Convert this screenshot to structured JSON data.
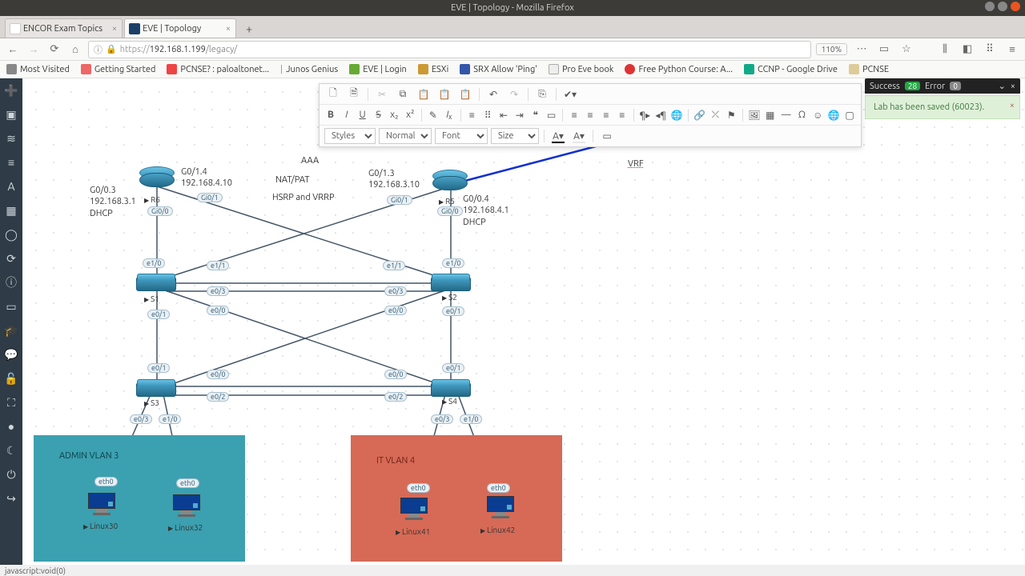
{
  "window_title": "EVE | Topology - Mozilla Firefox",
  "tabs": [
    {
      "label": "ENCOR Exam Topics",
      "active": false
    },
    {
      "label": "EVE | Topology",
      "active": true
    }
  ],
  "url": {
    "proto": "https://",
    "host": "192.168.1.199",
    "path": "/legacy/"
  },
  "zoom": "110%",
  "bookmarks": [
    {
      "label": "Most Visited",
      "color": "#888"
    },
    {
      "label": "Getting Started",
      "color": "#e66"
    },
    {
      "label": "PCNSE? : paloaltonet...",
      "color": "#e44"
    },
    {
      "label": "Junos Genius",
      "color": "#39a"
    },
    {
      "label": "EVE | Login",
      "color": "#6a3"
    },
    {
      "label": "ESXi",
      "color": "#c93"
    },
    {
      "label": "SRX Allow 'Ping'",
      "color": "#35a"
    },
    {
      "label": "Pro Eve book",
      "color": "#777"
    },
    {
      "label": "Free Python Course: A...",
      "color": "#d33"
    },
    {
      "label": "CCNP - Google Drive",
      "color": "#1a8"
    },
    {
      "label": "PCNSE",
      "color": "#aa8"
    }
  ],
  "notif": {
    "success_label": "Success",
    "success_count": "28",
    "error_label": "Error",
    "error_count": "0",
    "msg": "Lab has been saved (60023)."
  },
  "editor": {
    "styles": "Styles",
    "format": "Normal",
    "font": "Font",
    "size": "Size"
  },
  "topo": {
    "text_aaa": "AAA",
    "text_natpat": "NAT/PAT",
    "text_hsrp": "HSRP and VRRP",
    "text_vrf": "VRF",
    "r6_block": "G0/0.3\n192.168.3.1\nDHCP",
    "r6_g014": "G0/1.4\n192.168.4.10",
    "r5_g013": "G0/1.3\n192.168.3.10",
    "r5_block": "G0/0.4\n192.168.4.1\nDHCP",
    "nodes": {
      "r6": "R6",
      "r5": "R5",
      "s1": "S1",
      "s2": "S2",
      "s3": "S3",
      "s4": "S4",
      "l30": "Linux30",
      "l32": "Linux32",
      "l41": "Linux41",
      "l42": "Linux42"
    },
    "vlan3": "ADMIN VLAN 3",
    "vlan4": "IT VLAN 4",
    "ports": {
      "r6_gi01": "Gi0/1",
      "r6_gi00": "Gi0/0",
      "r5_gi01": "Gi0/1",
      "r5_gi00": "Gi0/0",
      "s1_e10": "e1/0",
      "s1_e11": "e1/1",
      "s1_e03": "e0/3",
      "s1_e00": "e0/0",
      "s1_e01": "e0/1",
      "s2_e10": "e1/0",
      "s2_e11": "e1/1",
      "s2_e03": "e0/3",
      "s2_e00": "e0/0",
      "s2_e01": "e0/1",
      "s1b_e01": "e0/1",
      "s3_e00a": "e0/0",
      "s3_e00b": "e0/0",
      "s3_e02": "e0/2",
      "s4_e00a": "e0/0",
      "s4_e00b": "e0/0",
      "s4_e02": "e0/2",
      "s3_e03": "e0/3",
      "s3_e10": "e1/0",
      "s4_e03": "e0/3",
      "s4_e10": "e1/0",
      "eth0_a": "eth0",
      "eth0_b": "eth0",
      "eth0_c": "eth0",
      "eth0_d": "eth0"
    }
  },
  "status": "javascript:void(0)"
}
